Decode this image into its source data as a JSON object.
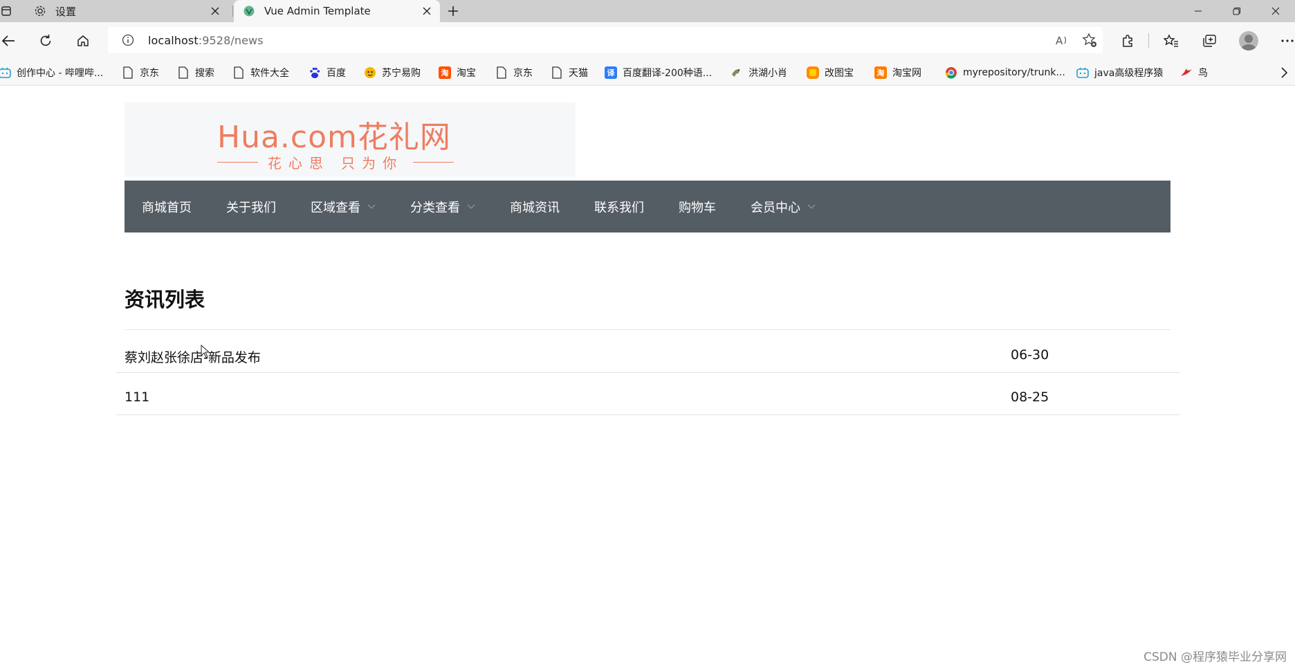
{
  "browser": {
    "tabs": [
      {
        "title": "设置",
        "icon": "gear-icon",
        "active": false
      },
      {
        "title": "Vue Admin Template",
        "icon": "vue-logo-icon",
        "active": true
      }
    ],
    "address": {
      "host": "localhost",
      "path": ":9528/news"
    },
    "bookmarks": [
      {
        "label": "创作中心 - 哔哩哔...",
        "icon": "bilibili-icon"
      },
      {
        "label": "京东",
        "icon": "page-icon"
      },
      {
        "label": "搜索",
        "icon": "page-icon"
      },
      {
        "label": "软件大全",
        "icon": "page-icon"
      },
      {
        "label": "百度",
        "icon": "baidu-paw-icon"
      },
      {
        "label": "苏宁易购",
        "icon": "suning-icon"
      },
      {
        "label": "淘宝",
        "icon": "taobao-icon"
      },
      {
        "label": "京东",
        "icon": "page-icon"
      },
      {
        "label": "天猫",
        "icon": "page-icon"
      },
      {
        "label": "百度翻译-200种语...",
        "icon": "translate-icon"
      },
      {
        "label": "洪湖小肖",
        "icon": "bird-avatar-icon"
      },
      {
        "label": "改图宝",
        "icon": "gaitubao-icon"
      },
      {
        "label": "淘宝网",
        "icon": "taobao-icon"
      },
      {
        "label": "myrepository/trunk...",
        "icon": "chrome-icon"
      },
      {
        "label": "java高级程序猿",
        "icon": "bilibili-icon"
      },
      {
        "label": "鸟",
        "icon": "bird-icon"
      }
    ]
  },
  "site": {
    "logo": {
      "main": "Hua.com花礼网",
      "sub": "花心思 只为你"
    },
    "nav": [
      {
        "label": "商城首页",
        "dropdown": false
      },
      {
        "label": "关于我们",
        "dropdown": false
      },
      {
        "label": "区域查看",
        "dropdown": true
      },
      {
        "label": "分类查看",
        "dropdown": true
      },
      {
        "label": "商城资讯",
        "dropdown": false
      },
      {
        "label": "联系我们",
        "dropdown": false
      },
      {
        "label": "购物车",
        "dropdown": false
      },
      {
        "label": "会员中心",
        "dropdown": true
      }
    ],
    "nav_bg": "#545c64",
    "logo_color": "#ee7d5f"
  },
  "news": {
    "title": "资讯列表",
    "items": [
      {
        "title": "蔡刘赵张徐店-新品发布",
        "date": "06-30"
      },
      {
        "title": "111",
        "date": "08-25"
      }
    ]
  },
  "watermark": "CSDN @程序猿毕业分享网"
}
